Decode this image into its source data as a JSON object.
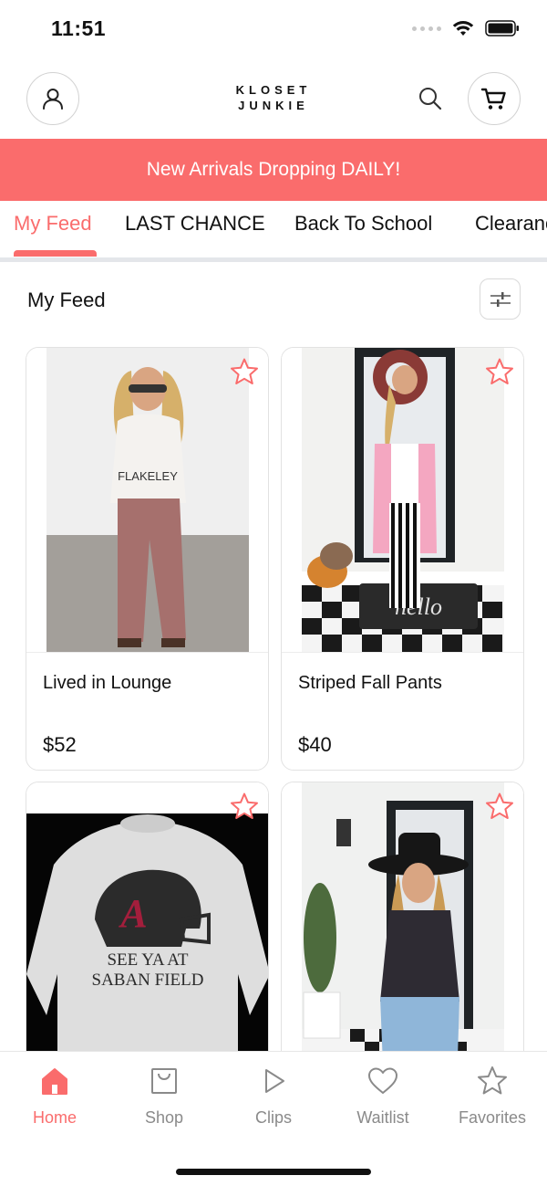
{
  "status_bar": {
    "time": "11:51"
  },
  "header": {
    "logo_line1": "KLOSET",
    "logo_line2": "JUNKIE",
    "account_icon": "person-icon",
    "search_icon": "search-icon",
    "cart_icon": "cart-icon"
  },
  "banner": {
    "text": "New Arrivals Dropping DAILY!"
  },
  "tabs": [
    {
      "label": "My Feed",
      "active": true
    },
    {
      "label": "LAST CHANCE",
      "active": false
    },
    {
      "label": "Back To School",
      "active": false
    },
    {
      "label": "Clearance",
      "active": false
    }
  ],
  "feed": {
    "title": "My Feed",
    "filter_icon": "sliders-icon"
  },
  "products": [
    {
      "name": "Lived in Lounge",
      "price": "$52"
    },
    {
      "name": "Striped Fall Pants",
      "price": "$40"
    },
    {
      "name": "",
      "price": "",
      "print_line1": "SEE YA AT",
      "print_line2": "SABAN FIELD"
    },
    {
      "name": "",
      "price": ""
    }
  ],
  "bottom_nav": [
    {
      "label": "Home",
      "icon": "home-icon",
      "active": true
    },
    {
      "label": "Shop",
      "icon": "shopping-bag-icon",
      "active": false
    },
    {
      "label": "Clips",
      "icon": "play-icon",
      "active": false
    },
    {
      "label": "Waitlist",
      "icon": "heart-icon",
      "active": false
    },
    {
      "label": "Favorites",
      "icon": "star-icon",
      "active": false
    }
  ],
  "colors": {
    "accent": "#fa6c6c",
    "muted": "#8a8a8a"
  }
}
